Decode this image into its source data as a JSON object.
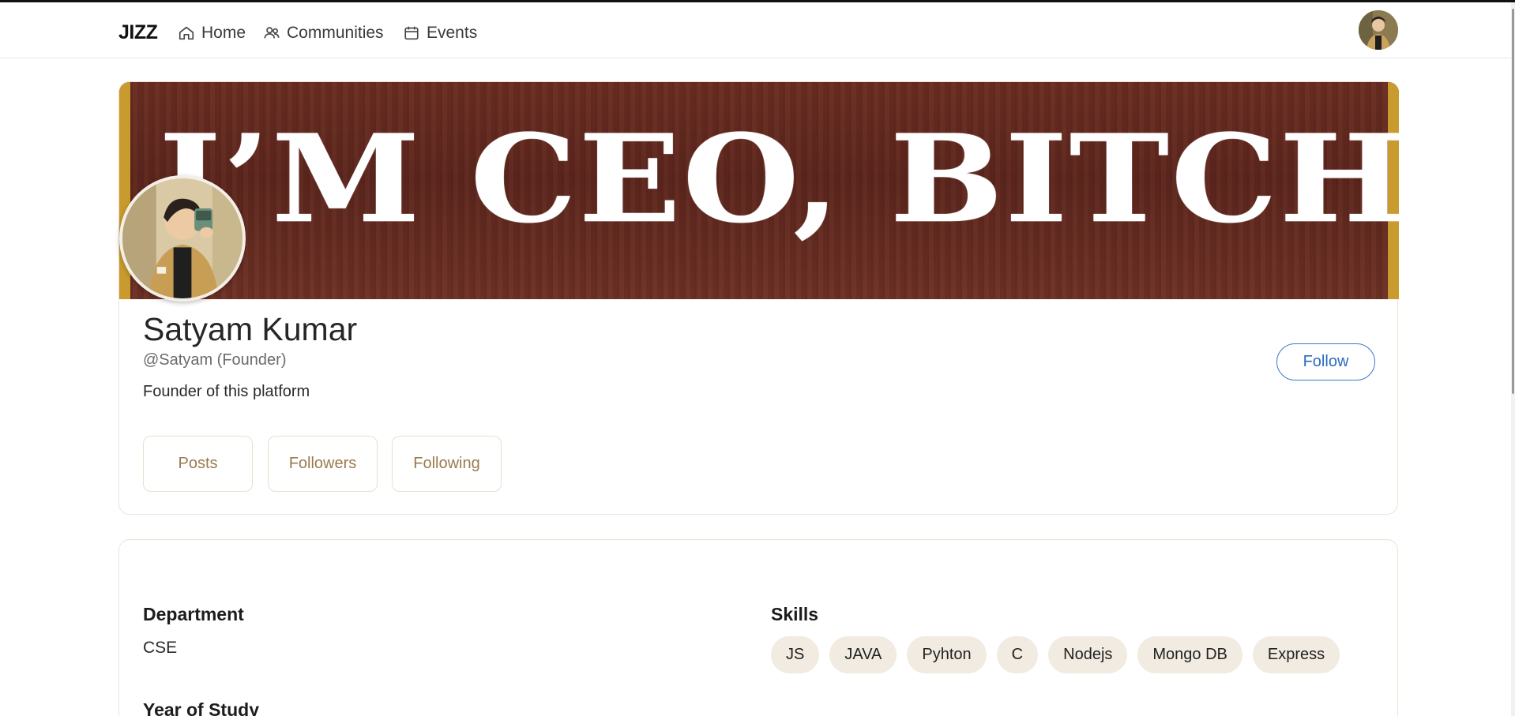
{
  "navbar": {
    "brand": "JIZZ",
    "links": [
      {
        "label": "Home",
        "icon": "home-icon"
      },
      {
        "label": "Communities",
        "icon": "users-icon"
      },
      {
        "label": "Events",
        "icon": "calendar-icon"
      }
    ],
    "avatar_icon": "user-avatar"
  },
  "profile": {
    "banner_text": "I’M CEO, BITCH",
    "name": "Satyam Kumar",
    "handle": "@Satyam (Founder)",
    "bio": "Founder of this platform",
    "follow_label": "Follow",
    "stats": {
      "posts_label": "Posts",
      "followers_label": "Followers",
      "following_label": "Following"
    }
  },
  "details": {
    "department_heading": "Department",
    "department_value": "CSE",
    "skills_heading": "Skills",
    "skills": [
      "JS",
      "JAVA",
      "Pyhton",
      "C",
      "Nodejs",
      "Mongo DB",
      "Express"
    ],
    "year_heading": "Year of Study"
  },
  "colors": {
    "accent_blue": "#2c6bc0",
    "stat_text": "#9a7b4f",
    "chip_bg": "#f1ebe1",
    "banner_bg": "#5d261d",
    "banner_edge": "#c99a2e"
  }
}
